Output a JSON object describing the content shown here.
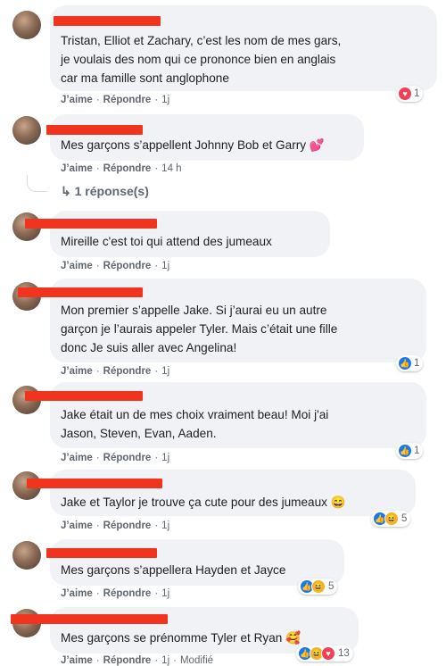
{
  "comments": [
    {
      "text": "Tristan, Elliot et Zachary, c’est les nom de mes gars,\nje voulais des nom qui ce prononce bien en anglais\ncar ma famille sont anglophone",
      "like": "J’aime",
      "reply": "Répondre",
      "time": "1j",
      "reactions": {
        "icons": [
          "love-icon"
        ],
        "count": "1"
      }
    },
    {
      "text": "Mes garçons s’appellent Johnny Bob et Garry 💕",
      "like": "J’aime",
      "reply": "Répondre",
      "time": "14 h",
      "replies_link": "1 réponse(s)"
    },
    {
      "text": "Mireille c'est toi qui attend des jumeaux",
      "like": "J’aime",
      "reply": "Répondre",
      "time": "1j"
    },
    {
      "text": "Mon premier s’appelle Jake. Si j’aurai eu un autre\ngarçon je l’aurais appeler Tyler. Mais c’était une fille\ndonc Je suis aller avec Angelina!",
      "like": "J’aime",
      "reply": "Répondre",
      "time": "1j",
      "reactions": {
        "icons": [
          "like-icon"
        ],
        "count": "1"
      }
    },
    {
      "text": "Jake était un de mes choix vraiment beau! Moi j'ai\nJason, Steven, Evan, Aaden.",
      "like": "J’aime",
      "reply": "Répondre",
      "time": "1j",
      "reactions": {
        "icons": [
          "like-icon"
        ],
        "count": "1"
      }
    },
    {
      "text": "Jake et Taylor je trouve ça cute pour des jumeaux 😄",
      "like": "J’aime",
      "reply": "Répondre",
      "time": "1j",
      "reactions": {
        "icons": [
          "like-icon",
          "haha-icon"
        ],
        "count": "5"
      }
    },
    {
      "text": "Mes garçons s’appellera Hayden et Jayce",
      "like": "J’aime",
      "reply": "Répondre",
      "time": "1j",
      "reactions": {
        "icons": [
          "like-icon",
          "haha-icon"
        ],
        "count": "5"
      }
    },
    {
      "text": "Mes garçons se prénomme Tyler et Ryan 🥰",
      "like": "J’aime",
      "reply": "Répondre",
      "time": "1j",
      "edited": "Modifié",
      "reactions": {
        "icons": [
          "like-icon",
          "haha-icon",
          "love-icon"
        ],
        "count": "13"
      }
    }
  ],
  "colors": {
    "redaction": "#f0341e",
    "bubble": "#f0f2f5",
    "like": "#1877f2",
    "love": "#f33e58"
  }
}
